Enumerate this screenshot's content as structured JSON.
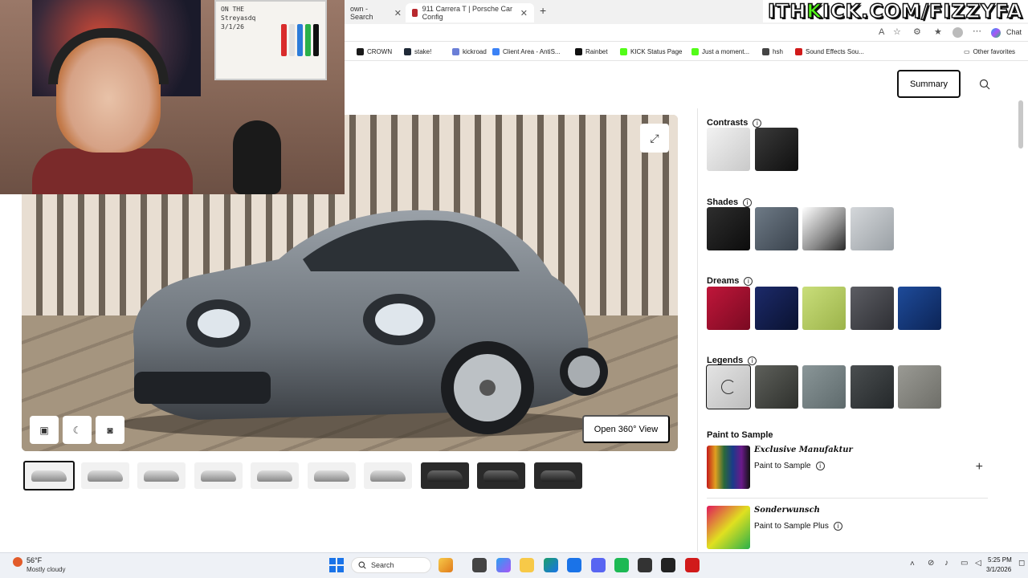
{
  "browser": {
    "tabs": [
      {
        "label": "own - Search",
        "close": "✕"
      },
      {
        "label": "911 Carrera T | Porsche Car Config",
        "close": "✕"
      }
    ],
    "new_tab": "+",
    "chat_label": "Chat",
    "favorites": [
      {
        "label": "CROWN",
        "color": "#1a1a1a"
      },
      {
        "label": "stake!",
        "color": "#1f2937"
      },
      {
        "label": "kickroad",
        "color": "#6b7fd7"
      },
      {
        "label": "Client Area - AntiS...",
        "color": "#3b82f6"
      },
      {
        "label": "Rainbet",
        "color": "#111111"
      },
      {
        "label": "KICK Status Page",
        "color": "#53fc18"
      },
      {
        "label": "Just a moment...",
        "color": "#53fc18"
      },
      {
        "label": "hsh",
        "color": "#444444"
      },
      {
        "label": "Sound Effects Sou...",
        "color": "#d11a1a"
      }
    ],
    "other_favorites": "Other favorites"
  },
  "stream_overlay": {
    "brand_prefix": "ITH",
    "brand_k": "K",
    "brand_rest": "ICK.COM/FIZZYFA",
    "whiteboard_note": "ON THE\nStreyasdq\n3/1/26"
  },
  "header": {
    "summary_label": "Summary",
    "search_icon": "search-icon"
  },
  "viewer": {
    "expand_icon": "expand-icon",
    "controls": [
      "image-icon",
      "moon-icon",
      "camera-icon"
    ],
    "open360_label": "Open 360° View",
    "thumbnails": [
      {
        "dark": false,
        "active": true
      },
      {
        "dark": false,
        "active": false
      },
      {
        "dark": false,
        "active": false
      },
      {
        "dark": false,
        "active": false
      },
      {
        "dark": false,
        "active": false
      },
      {
        "dark": false,
        "active": false
      },
      {
        "dark": false,
        "active": false
      },
      {
        "dark": true,
        "active": false
      },
      {
        "dark": true,
        "active": false
      },
      {
        "dark": true,
        "active": false
      }
    ]
  },
  "config": {
    "sections": [
      {
        "title": "Contrasts",
        "swatches": [
          {
            "color": "linear-gradient(135deg,#f2f2f2,#c9c9c9)"
          },
          {
            "color": "linear-gradient(135deg,#3a3a3a,#0f0f0f)"
          }
        ]
      },
      {
        "title": "Shades",
        "swatches": [
          {
            "color": "linear-gradient(135deg,#2e2e2e,#0c0c0c)"
          },
          {
            "color": "linear-gradient(135deg,#6e7a86,#3a434d)"
          },
          {
            "color": "linear-gradient(135deg,#ffffff,#8a8a8a 60%,#2a2a2a)"
          },
          {
            "color": "linear-gradient(135deg,#d4d7da,#9aa0a5)"
          }
        ]
      },
      {
        "title": "Dreams",
        "swatches": [
          {
            "color": "linear-gradient(135deg,#c0163a,#7a0a22)"
          },
          {
            "color": "linear-gradient(135deg,#1c2a6a,#0a1230)"
          },
          {
            "color": "linear-gradient(135deg,#c9de7a,#9cb34a)"
          },
          {
            "color": "linear-gradient(135deg,#5c5d63,#2e2f34)"
          },
          {
            "color": "linear-gradient(135deg,#1e4b9a,#0c2456)"
          }
        ]
      },
      {
        "title": "Legends",
        "swatches": [
          {
            "color": "linear-gradient(135deg,#e4e4e4,#bdbdbd)",
            "selected": true,
            "loading": true
          },
          {
            "color": "linear-gradient(135deg,#5e605b,#2e302c)"
          },
          {
            "color": "linear-gradient(135deg,#8a9698,#5e6a6c)"
          },
          {
            "color": "linear-gradient(135deg,#4a4e50,#24282a)"
          },
          {
            "color": "linear-gradient(135deg,#9a9a94,#6e6e68)"
          }
        ]
      }
    ],
    "paint_to_sample": {
      "title": "Paint to Sample",
      "options": [
        {
          "script": "Exclusive Manufaktur",
          "label": "Paint to Sample",
          "plus": "+"
        },
        {
          "script": "Sonderwunsch",
          "label": "Paint to Sample Plus"
        }
      ]
    }
  },
  "taskbar": {
    "weather_temp": "56°F",
    "weather_desc": "Mostly cloudy",
    "search_label": "Search",
    "time": "5:25 PM",
    "date": "3/1/2026"
  }
}
